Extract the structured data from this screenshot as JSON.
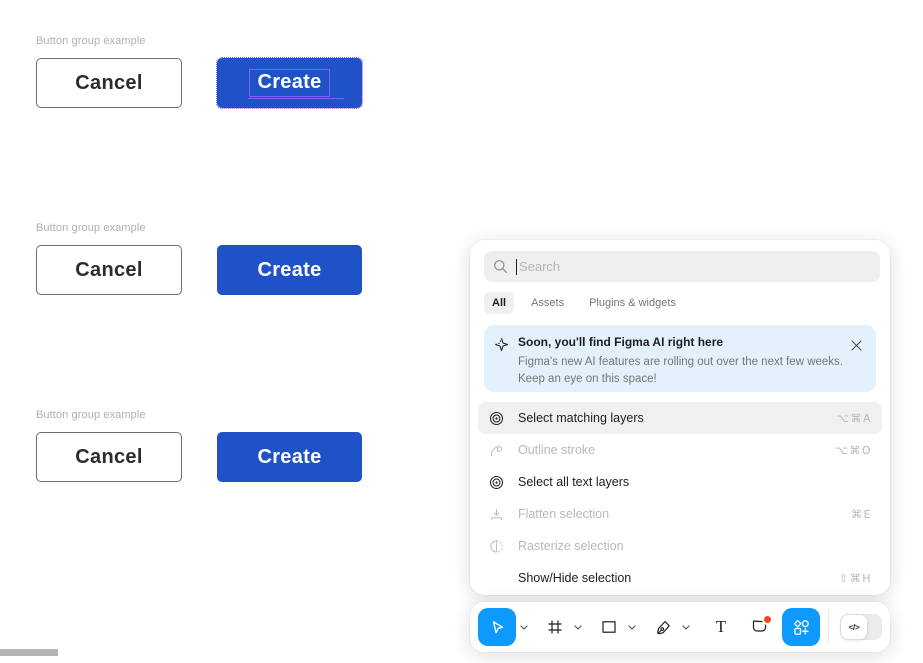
{
  "canvas": {
    "groups": [
      {
        "label": "Button group example",
        "cancel_label": "Cancel",
        "create_label": "Create",
        "selected": true
      },
      {
        "label": "Button group example",
        "cancel_label": "Cancel",
        "create_label": "Create",
        "selected": false
      },
      {
        "label": "Button group example",
        "cancel_label": "Cancel",
        "create_label": "Create",
        "selected": false
      }
    ]
  },
  "palette": {
    "search": {
      "placeholder": "Search",
      "icon": "search-icon"
    },
    "tabs": [
      {
        "label": "All",
        "active": true
      },
      {
        "label": "Assets",
        "active": false
      },
      {
        "label": "Plugins & widgets",
        "active": false
      }
    ],
    "banner": {
      "icon": "ai-sparkle-icon",
      "title": "Soon, you'll find Figma AI right here",
      "description": "Figma's new AI features are rolling out over the next few weeks. Keep an eye on this space!",
      "close_icon": "close-icon"
    },
    "menu": [
      {
        "icon": "select-matching-icon",
        "label": "Select matching layers",
        "shortcut": "⌥⌘A",
        "enabled": true,
        "highlighted": true
      },
      {
        "icon": "outline-stroke-icon",
        "label": "Outline stroke",
        "shortcut": "⌥⌘O",
        "enabled": false,
        "highlighted": false
      },
      {
        "icon": "select-matching-icon",
        "label": "Select all text layers",
        "shortcut": "",
        "enabled": true,
        "highlighted": false
      },
      {
        "icon": "flatten-icon",
        "label": "Flatten selection",
        "shortcut": "⌘E",
        "enabled": false,
        "highlighted": false
      },
      {
        "icon": "rasterize-icon",
        "label": "Rasterize selection",
        "shortcut": "",
        "enabled": false,
        "highlighted": false
      },
      {
        "icon": "",
        "label": "Show/Hide selection",
        "shortcut": "⇧⌘H",
        "enabled": true,
        "highlighted": false
      }
    ]
  },
  "toolbar": {
    "tools": [
      {
        "name": "move-tool",
        "selected": true,
        "has_dropdown": true
      },
      {
        "name": "frame-tool",
        "selected": false,
        "has_dropdown": true
      },
      {
        "name": "shape-tool",
        "selected": false,
        "has_dropdown": true
      },
      {
        "name": "pen-tool",
        "selected": false,
        "has_dropdown": true
      },
      {
        "name": "text-tool",
        "selected": false,
        "has_dropdown": false
      },
      {
        "name": "comment-tool",
        "selected": false,
        "has_dropdown": false,
        "notification": true
      },
      {
        "name": "actions-button",
        "selected": true,
        "has_dropdown": false
      }
    ],
    "text_tool_glyph": "T",
    "dev_mode": {
      "state": "off",
      "icon_label": "</>"
    }
  },
  "colors": {
    "accent_blue": "#0D99FF",
    "primary_button_blue": "#1E52C6",
    "selection_purple": "#9747FF",
    "text_selection_purple": "#7B61FF",
    "banner_bg": "#E3F1FC",
    "notification_red": "#F24822"
  }
}
